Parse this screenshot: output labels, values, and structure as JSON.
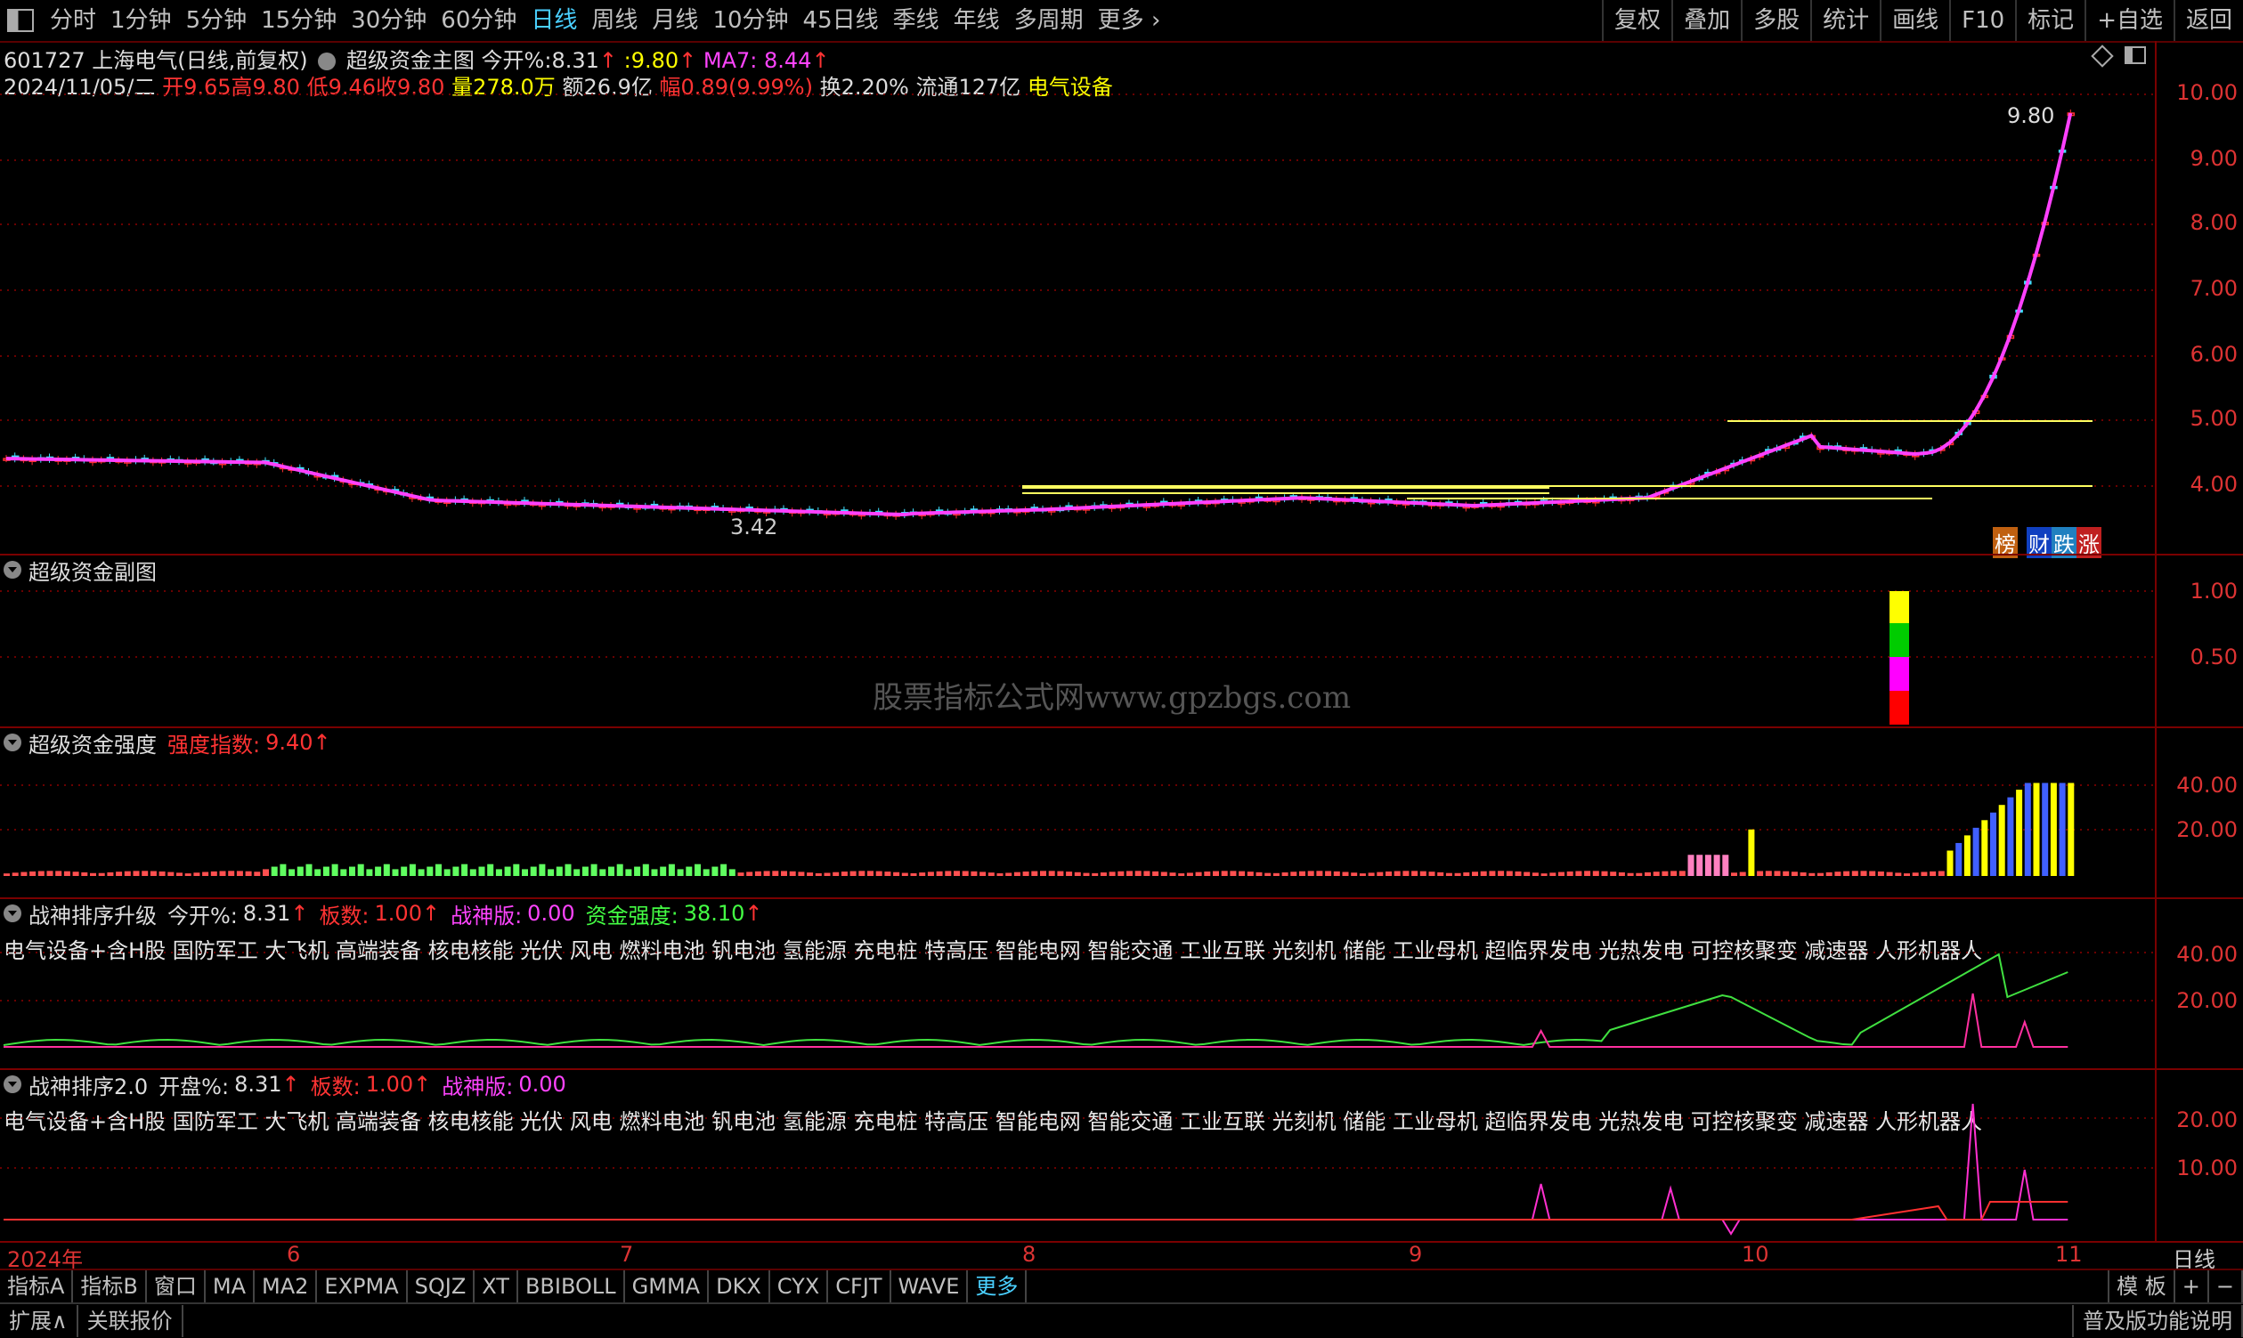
{
  "toolbar": {
    "timeframes": [
      "分时",
      "1分钟",
      "5分钟",
      "15分钟",
      "30分钟",
      "60分钟",
      "日线",
      "周线",
      "月线",
      "10分钟",
      "45日线",
      "季线",
      "年线",
      "多周期",
      "更多"
    ],
    "active_timeframe": "日线",
    "right_buttons": [
      "复权",
      "叠加",
      "多股",
      "统计",
      "画线",
      "F10",
      "标记",
      "+自选",
      "返回"
    ]
  },
  "main": {
    "title_code": "601727",
    "title_name": "上海电气(日线,前复权)",
    "indicator_name": "超级资金主图",
    "today_open_label": "今开%:",
    "today_open_value": "8.31",
    "price_label": ":",
    "price_value": "9.80",
    "ma_label": "MA7:",
    "ma_value": "8.44",
    "date": "2024/11/05/二",
    "open_label": "开",
    "open": "9.65",
    "high_label": "高",
    "high": "9.80",
    "low_label": "低",
    "low": "9.46",
    "close_label": "收",
    "close": "9.80",
    "vol_label": "量",
    "vol": "278.0万",
    "amount_label": "额",
    "amount": "26.9亿",
    "amp_label": "幅",
    "amp": "0.89(9.99%)",
    "turnover_label": "换",
    "turnover": "2.20%",
    "float_label": "流通",
    "float": "127亿",
    "sector": "电气设备",
    "price_ticks": [
      "10.00",
      "9.00",
      "8.00",
      "7.00",
      "6.00",
      "5.00",
      "4.00"
    ],
    "low_annotation": "3.42",
    "high_annotation": "9.80",
    "badges": [
      "榜",
      "财",
      "跌",
      "涨"
    ]
  },
  "sub1": {
    "title": "超级资金副图",
    "ticks": [
      "1.00",
      "0.50"
    ],
    "watermark": "股票指标公式网www.gpzbgs.com"
  },
  "sub2": {
    "title": "超级资金强度",
    "index_label": "强度指数:",
    "index_value": "9.40",
    "ticks": [
      "40.00",
      "20.00"
    ]
  },
  "sub3": {
    "title": "战神排序升级",
    "open_label": "今开%:",
    "open_value": "8.31",
    "board_label": "板数:",
    "board_value": "1.00",
    "version_label": "战神版:",
    "version_value": "0.00",
    "fund_label": "资金强度:",
    "fund_value": "38.10",
    "sectors": "电气设备+含H股 国防军工 大飞机 高端装备 核电核能 光伏 风电 燃料电池 钒电池 氢能源 充电桩 特高压 智能电网 智能交通 工业互联 光刻机 储能 工业母机 超临界发电 光热发电 可控核聚变 减速器 人形机器人",
    "ticks": [
      "40.00",
      "20.00"
    ]
  },
  "sub4": {
    "title": "战神排序2.0",
    "open_label": "开盘%:",
    "open_value": "8.31",
    "board_label": "板数:",
    "board_value": "1.00",
    "version_label": "战神版:",
    "version_value": "0.00",
    "sectors": "电气设备+含H股 国防军工 大飞机 高端装备 核电核能 光伏 风电 燃料电池 钒电池 氢能源 充电桩 特高压 智能电网 智能交通 工业互联 光刻机 储能 工业母机 超临界发电 光热发电 可控核聚变 减速器 人形机器人",
    "ticks": [
      "20.00",
      "10.00"
    ]
  },
  "date_axis": {
    "labels": [
      "2024年",
      "6",
      "7",
      "8",
      "9",
      "10",
      "11"
    ],
    "period": "日线"
  },
  "bottom1": {
    "tabs": [
      "指标A",
      "指标B",
      "窗口",
      "MA",
      "MA2",
      "EXPMA",
      "SQJZ",
      "XT",
      "BBIBOLL",
      "GMMA",
      "DKX",
      "CYX",
      "CFJT",
      "WAVE",
      "更多"
    ],
    "right": [
      "模 板",
      "+",
      "−"
    ]
  },
  "bottom2": {
    "left": [
      "扩展∧",
      "关联报价"
    ],
    "right": "普及版功能说明"
  },
  "colors": {
    "up": "#ff3030",
    "down": "#40e0ff",
    "ma": "#ff40ff",
    "axis": "#d33"
  }
}
